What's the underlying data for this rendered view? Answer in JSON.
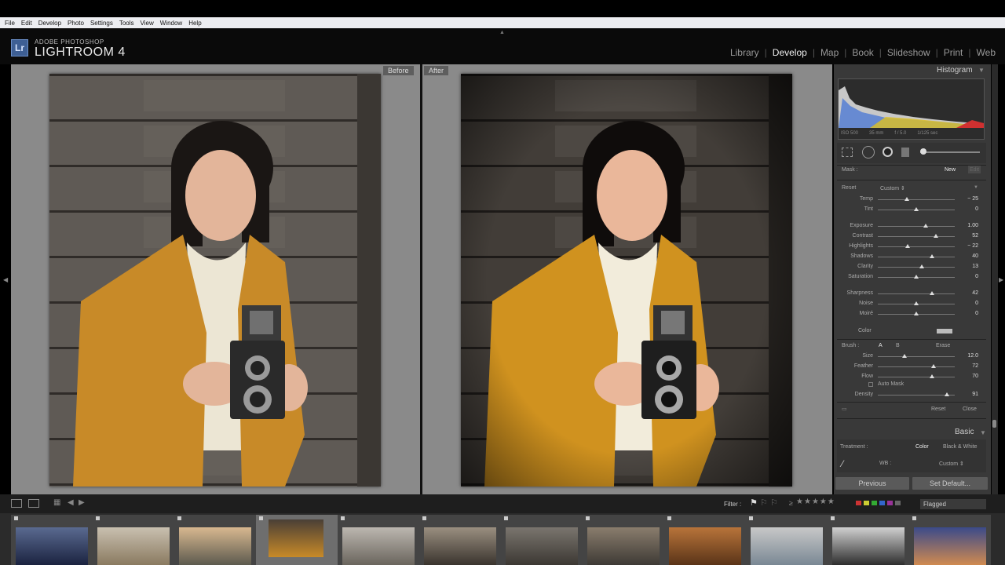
{
  "menu": [
    "File",
    "Edit",
    "Develop",
    "Photo",
    "Settings",
    "Tools",
    "View",
    "Window",
    "Help"
  ],
  "brand": {
    "small": "ADOBE PHOTOSHOP",
    "big": "LIGHTROOM 4",
    "badge": "Lr"
  },
  "modules": [
    {
      "label": "Library",
      "active": false
    },
    {
      "label": "Develop",
      "active": true
    },
    {
      "label": "Map",
      "active": false
    },
    {
      "label": "Book",
      "active": false
    },
    {
      "label": "Slideshow",
      "active": false
    },
    {
      "label": "Print",
      "active": false
    },
    {
      "label": "Web",
      "active": false
    }
  ],
  "view": {
    "before": "Before",
    "after": "After"
  },
  "histogram": {
    "title": "Histogram",
    "iso": "ISO 500",
    "focal": "35 mm",
    "aperture": "f / 5.0",
    "shutter": "1/125 sec"
  },
  "mask": {
    "label": "Mask :",
    "new": "New",
    "edit": "Edit"
  },
  "adjust": {
    "reset": "Reset",
    "preset": "Custom ⇕"
  },
  "sliders": [
    {
      "label": "Temp",
      "value": "− 25",
      "pos": 0.38
    },
    {
      "label": "Tint",
      "value": "0",
      "pos": 0.5
    },
    {
      "label": "Exposure",
      "value": "1.00",
      "pos": 0.62
    },
    {
      "label": "Contrast",
      "value": "52",
      "pos": 0.76
    },
    {
      "label": "Highlights",
      "value": "− 22",
      "pos": 0.39
    },
    {
      "label": "Shadows",
      "value": "40",
      "pos": 0.7
    },
    {
      "label": "Clarity",
      "value": "13",
      "pos": 0.57
    },
    {
      "label": "Saturation",
      "value": "0",
      "pos": 0.5
    },
    {
      "label": "Sharpness",
      "value": "42",
      "pos": 0.7
    },
    {
      "label": "Noise",
      "value": "0",
      "pos": 0.5
    },
    {
      "label": "Moiré",
      "value": "0",
      "pos": 0.5
    }
  ],
  "color_label": "Color",
  "brush": {
    "label": "Brush :",
    "a": "A",
    "b": "B",
    "erase": "Erase"
  },
  "brush_sliders": [
    {
      "label": "Size",
      "value": "12.0",
      "pos": 0.35
    },
    {
      "label": "Feather",
      "value": "72",
      "pos": 0.72
    },
    {
      "label": "Flow",
      "value": "70",
      "pos": 0.7
    }
  ],
  "automask": "Auto Mask",
  "density": {
    "label": "Density",
    "value": "91",
    "pos": 0.9
  },
  "panel_footer": {
    "reset": "Reset",
    "close": "Close"
  },
  "basic": {
    "title": "Basic",
    "treatment": "Treatment :",
    "color": "Color",
    "bw": "Black & White",
    "wb": "WB :",
    "wb_value": "Custom ⇕"
  },
  "buttons": {
    "previous": "Previous",
    "set_default": "Set Default..."
  },
  "filter": {
    "label": "Filter :",
    "rating": "≥",
    "flagged": "Flagged"
  },
  "colors": {
    "accent": "#3e5f94",
    "panel": "#393939",
    "workspace": "#8a8a8a"
  }
}
